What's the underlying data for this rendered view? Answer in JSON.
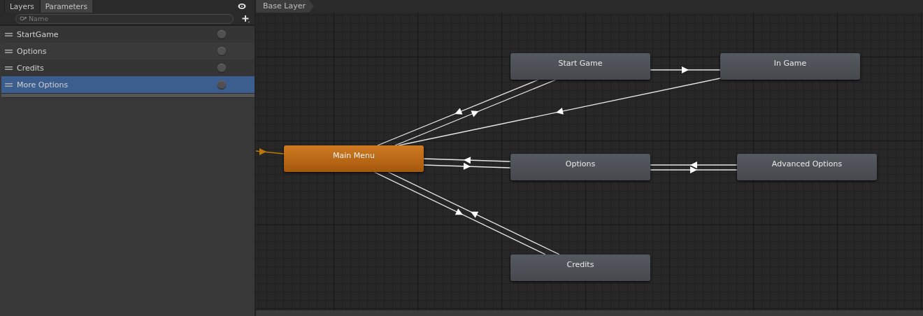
{
  "tabs": [
    {
      "label": "Layers",
      "selected": false
    },
    {
      "label": "Parameters",
      "selected": true
    }
  ],
  "search": {
    "placeholder": "Name"
  },
  "parameters": [
    {
      "name": "StartGame",
      "selected": false,
      "checked": false
    },
    {
      "name": "Options",
      "selected": false,
      "checked": false
    },
    {
      "name": "Credits",
      "selected": false,
      "checked": false
    },
    {
      "name": "More Options",
      "selected": true,
      "checked": false
    }
  ],
  "breadcrumb": "Base Layer",
  "states": [
    {
      "name": "Start Game",
      "kind": "normal"
    },
    {
      "name": "In Game",
      "kind": "normal"
    },
    {
      "name": "Main Menu",
      "kind": "default"
    },
    {
      "name": "Options",
      "kind": "normal"
    },
    {
      "name": "Advanced Options",
      "kind": "normal"
    },
    {
      "name": "Credits",
      "kind": "normal"
    }
  ]
}
